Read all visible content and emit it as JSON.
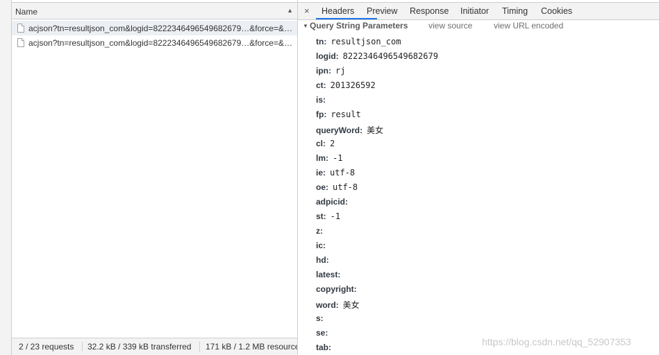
{
  "request_list": {
    "header_label": "Name",
    "sort_indicator": "▲",
    "rows": [
      "acjson?tn=resultjson_com&logid=8222346496549682679…&force=&…",
      "acjson?tn=resultjson_com&logid=8222346496549682679…&force=&…"
    ]
  },
  "status_bar": {
    "requests": "2 / 23 requests",
    "transferred": "32.2 kB / 339 kB transferred",
    "resources": "171 kB / 1.2 MB resources"
  },
  "tabs": {
    "close_glyph": "×",
    "items": [
      "Headers",
      "Preview",
      "Response",
      "Initiator",
      "Timing",
      "Cookies"
    ],
    "active": "Headers"
  },
  "section": {
    "title": "Query String Parameters",
    "view_source": "view source",
    "view_url_encoded": "view URL encoded"
  },
  "params": [
    {
      "key": "tn:",
      "value": "resultjson_com"
    },
    {
      "key": "logid:",
      "value": "8222346496549682679"
    },
    {
      "key": "ipn:",
      "value": "rj"
    },
    {
      "key": "ct:",
      "value": "201326592"
    },
    {
      "key": "is:",
      "value": ""
    },
    {
      "key": "fp:",
      "value": "result"
    },
    {
      "key": "queryWord:",
      "value": "美女"
    },
    {
      "key": "cl:",
      "value": "2"
    },
    {
      "key": "lm:",
      "value": "-1"
    },
    {
      "key": "ie:",
      "value": "utf-8"
    },
    {
      "key": "oe:",
      "value": "utf-8"
    },
    {
      "key": "adpicid:",
      "value": ""
    },
    {
      "key": "st:",
      "value": "-1"
    },
    {
      "key": "z:",
      "value": ""
    },
    {
      "key": "ic:",
      "value": ""
    },
    {
      "key": "hd:",
      "value": ""
    },
    {
      "key": "latest:",
      "value": ""
    },
    {
      "key": "copyright:",
      "value": ""
    },
    {
      "key": "word:",
      "value": "美女"
    },
    {
      "key": "s:",
      "value": ""
    },
    {
      "key": "se:",
      "value": ""
    },
    {
      "key": "tab:",
      "value": ""
    }
  ],
  "watermark": "https://blog.csdn.net/qq_52907353"
}
